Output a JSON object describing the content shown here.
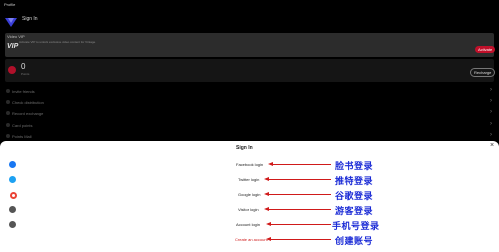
{
  "app": {
    "title": "Profile"
  },
  "header": {
    "sign_in": "Sign In"
  },
  "vip": {
    "title": "Video VIP",
    "badge": "VIP",
    "subtitle": "Activate VIP to unlock exclusive video content for Vintage",
    "activate_label": "Activate"
  },
  "wallet": {
    "amount": "0",
    "caption": "Points",
    "recharge_label": "Recharge"
  },
  "menu": [
    {
      "label": "Invite friends"
    },
    {
      "label": "Check distribution"
    },
    {
      "label": "Record exchange"
    },
    {
      "label": "Card points"
    },
    {
      "label": "Points Mall"
    }
  ],
  "sheet": {
    "title": "Sign In",
    "close": "×",
    "options": [
      {
        "icon": "facebook-icon",
        "label": "Facebook login",
        "annotation": "脸书登录",
        "color": "#1877f2"
      },
      {
        "icon": "twitter-icon",
        "label": "Twitter login",
        "annotation": "推特登录",
        "color": "#1da1f2"
      },
      {
        "icon": "google-icon",
        "label": "Google login",
        "annotation": "谷歌登录",
        "color": "#ea4335"
      },
      {
        "icon": "visitor-icon",
        "label": "Visitor login",
        "annotation": "游客登录",
        "color": "#555555"
      },
      {
        "icon": "account-icon",
        "label": "Account login",
        "annotation": "手机号登录",
        "color": "#555555"
      },
      {
        "icon": "",
        "label": "Create an account",
        "annotation": "创建账号",
        "color": "#d01a1a"
      }
    ]
  },
  "colors": {
    "accent": "#c0102a",
    "annotation": "#1b2bd6",
    "arrow": "#d01a1a"
  }
}
